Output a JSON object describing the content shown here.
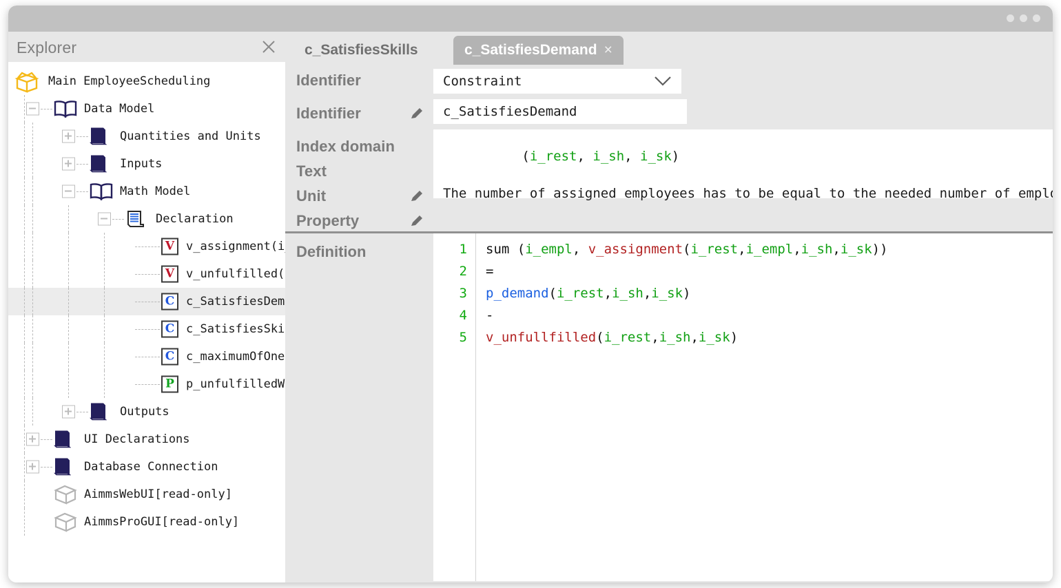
{
  "window": {
    "dots": [
      "minimize-dot",
      "maximize-dot",
      "close-dot"
    ]
  },
  "explorer": {
    "title": "Explorer",
    "close_icon": "close-icon",
    "tree": [
      {
        "label": "Main EmployeeScheduling",
        "icon": "open-box-icon",
        "depth": 0,
        "toggle": "none"
      },
      {
        "label": "Data Model",
        "icon": "open-book-icon",
        "depth": 1,
        "toggle": "minus"
      },
      {
        "label": "Quantities and Units",
        "icon": "closed-book-icon",
        "depth": 2,
        "toggle": "plus"
      },
      {
        "label": "Inputs",
        "icon": "closed-book-icon",
        "depth": 2,
        "toggle": "plus"
      },
      {
        "label": "Math Model",
        "icon": "open-book-icon",
        "depth": 2,
        "toggle": "minus"
      },
      {
        "label": "Declaration",
        "icon": "scroll-icon",
        "depth": 3,
        "toggle": "minus"
      },
      {
        "label": "v_assignment(i_",
        "icon": "variable-tag-icon",
        "tag": "V",
        "depth": 4,
        "toggle": "none"
      },
      {
        "label": "v_unfulfilled(i",
        "icon": "variable-tag-icon",
        "tag": "V",
        "depth": 4,
        "toggle": "none"
      },
      {
        "label": "c_SatisfiesDema",
        "icon": "constraint-tag-icon",
        "tag": "C",
        "depth": 4,
        "toggle": "none",
        "selected": true
      },
      {
        "label": "c_SatisfiesSkil",
        "icon": "constraint-tag-icon",
        "tag": "C",
        "depth": 4,
        "toggle": "none"
      },
      {
        "label": "c_maximumOfOneS",
        "icon": "constraint-tag-icon",
        "tag": "C",
        "depth": 4,
        "toggle": "none"
      },
      {
        "label": "p_unfulfilledWe",
        "icon": "parameter-tag-icon",
        "tag": "P",
        "depth": 4,
        "toggle": "none"
      },
      {
        "label": "Outputs",
        "icon": "closed-book-icon",
        "depth": 2,
        "toggle": "plus"
      },
      {
        "label": "UI Declarations",
        "icon": "closed-book-icon",
        "depth": 1,
        "toggle": "plus"
      },
      {
        "label": "Database Connection",
        "icon": "closed-book-icon",
        "depth": 1,
        "toggle": "plus"
      },
      {
        "label": "AimmsWebUI[read-only]",
        "icon": "cube-icon",
        "depth": 1,
        "toggle": "none"
      },
      {
        "label": "AimmsProGUI[read-only]",
        "icon": "cube-icon",
        "depth": 1,
        "toggle": "none"
      }
    ]
  },
  "tabs": [
    {
      "label": "c_SatisfiesSkills",
      "active": false
    },
    {
      "label": "c_SatisfiesDemand",
      "active": true,
      "close_icon": "close-icon"
    }
  ],
  "attributes": {
    "type_label": "Identifier",
    "type_value": "Constraint",
    "dropdown_icon": "chevron-down-icon",
    "name_label": "Identifier",
    "name_value": "c_SatisfiesDemand",
    "index_domain_label": "Index domain",
    "index_domain_open": "(",
    "index_domain_indices": [
      "i_rest",
      "i_sh",
      "i_sk"
    ],
    "index_domain_close": ")",
    "text_label": "Text",
    "text_value": "The number of assigned employees has to be equal to the needed number of emplo",
    "unit_label": "Unit",
    "property_label": "Property",
    "pencil_icon": "pencil-edit-icon"
  },
  "definition": {
    "label": "Definition",
    "line_numbers": [
      "1",
      "2",
      "3",
      "4",
      "5"
    ],
    "lines": [
      [
        {
          "t": "sum (",
          "c": "plain"
        },
        {
          "t": "i_empl",
          "c": "index"
        },
        {
          "t": ", ",
          "c": "plain"
        },
        {
          "t": "v_assignment",
          "c": "variable"
        },
        {
          "t": "(",
          "c": "plain"
        },
        {
          "t": "i_rest",
          "c": "index"
        },
        {
          "t": ",",
          "c": "plain"
        },
        {
          "t": "i_empl",
          "c": "index"
        },
        {
          "t": ",",
          "c": "plain"
        },
        {
          "t": "i_sh",
          "c": "index"
        },
        {
          "t": ",",
          "c": "plain"
        },
        {
          "t": "i_sk",
          "c": "index"
        },
        {
          "t": "))",
          "c": "plain"
        }
      ],
      [
        {
          "t": "=",
          "c": "plain"
        }
      ],
      [
        {
          "t": "p_demand",
          "c": "parameter"
        },
        {
          "t": "(",
          "c": "plain"
        },
        {
          "t": "i_rest",
          "c": "index"
        },
        {
          "t": ",",
          "c": "plain"
        },
        {
          "t": "i_sh",
          "c": "index"
        },
        {
          "t": ",",
          "c": "plain"
        },
        {
          "t": "i_sk",
          "c": "index"
        },
        {
          "t": ")",
          "c": "plain"
        }
      ],
      [
        {
          "t": "-",
          "c": "plain"
        }
      ],
      [
        {
          "t": "v_unfullfilled",
          "c": "variable"
        },
        {
          "t": "(",
          "c": "plain"
        },
        {
          "t": "i_rest",
          "c": "index"
        },
        {
          "t": ",",
          "c": "plain"
        },
        {
          "t": "i_sh",
          "c": "index"
        },
        {
          "t": ",",
          "c": "plain"
        },
        {
          "t": "i_sk",
          "c": "index"
        },
        {
          "t": ")",
          "c": "plain"
        }
      ]
    ]
  },
  "colors": {
    "titlebar": "#c1c1c1",
    "panel_bg": "#e7e7e7",
    "active_tab": "#b3b3b3",
    "variable_red": "#b22222",
    "parameter_blue": "#1a5fe0",
    "index_green": "#12a014",
    "lineno_green": "#11aa11",
    "book_navy": "#241f5c",
    "box_yellow": "#f5b919"
  }
}
